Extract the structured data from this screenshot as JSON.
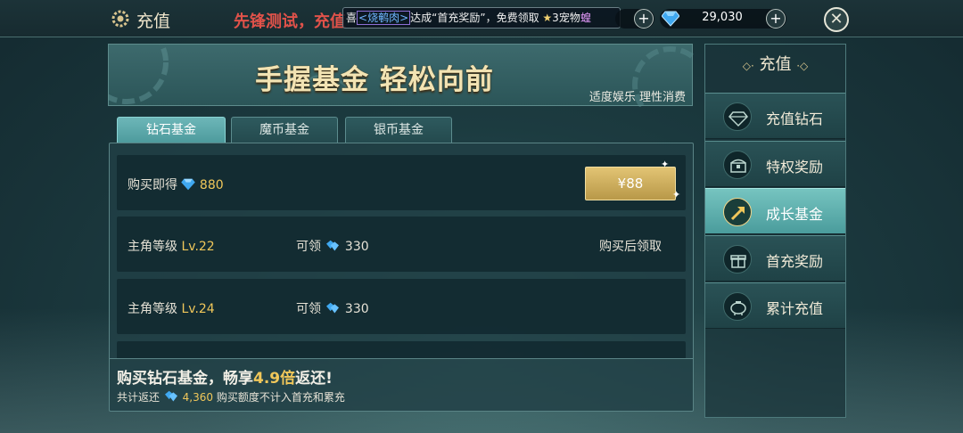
{
  "topbar": {
    "title": "充值",
    "marquee_red": "先锋测试，充值",
    "notice": {
      "prefix": "喜",
      "player": "<烧鹌肉>",
      "text": "达成“首充奖励”，免费领取",
      "star": "★",
      "reward": "3宠物",
      "trailing": "蝗"
    },
    "diamond_amount": "29,030",
    "plus_label": "+",
    "close_label": "✕"
  },
  "banner": {
    "title": "手握基金 轻松向前",
    "subtitle": "适度娱乐 理性消费"
  },
  "tabs": [
    {
      "label": "钻石基金",
      "active": true
    },
    {
      "label": "魔币基金",
      "active": false
    },
    {
      "label": "银币基金",
      "active": false
    }
  ],
  "purchase": {
    "label": "购买即得",
    "amount": "880",
    "price": "¥88"
  },
  "rewards": [
    {
      "label": "主角等级",
      "level": "Lv.22",
      "claim_label": "可领",
      "amount": "330",
      "status": "购买后领取"
    },
    {
      "label": "主角等级",
      "level": "Lv.24",
      "claim_label": "可领",
      "amount": "330",
      "status": ""
    }
  ],
  "footer": {
    "promo_prefix": "购买钻石基金，畅享",
    "promo_multiplier": "4.9倍",
    "promo_suffix": "返还!",
    "total_label": "共计返还",
    "total_amount": "4,360",
    "note": "购买额度不计入首充和累充"
  },
  "side_menu": {
    "title": "充值",
    "title_ornament_left": "◇·",
    "title_ornament_right": "·◇",
    "items": [
      {
        "label": "充值钻石",
        "icon": "diamond-icon",
        "active": false
      },
      {
        "label": "特权奖励",
        "icon": "treasure-chest-icon",
        "active": false
      },
      {
        "label": "成长基金",
        "icon": "growth-arrow-icon",
        "active": true
      },
      {
        "label": "首充奖励",
        "icon": "gift-icon",
        "active": false
      },
      {
        "label": "累计充值",
        "icon": "piggy-bank-icon",
        "active": false
      }
    ]
  },
  "colors": {
    "gold_text": "#f0c75a",
    "active_tab": "#6db6b8",
    "buy_button": "#d4b464"
  }
}
